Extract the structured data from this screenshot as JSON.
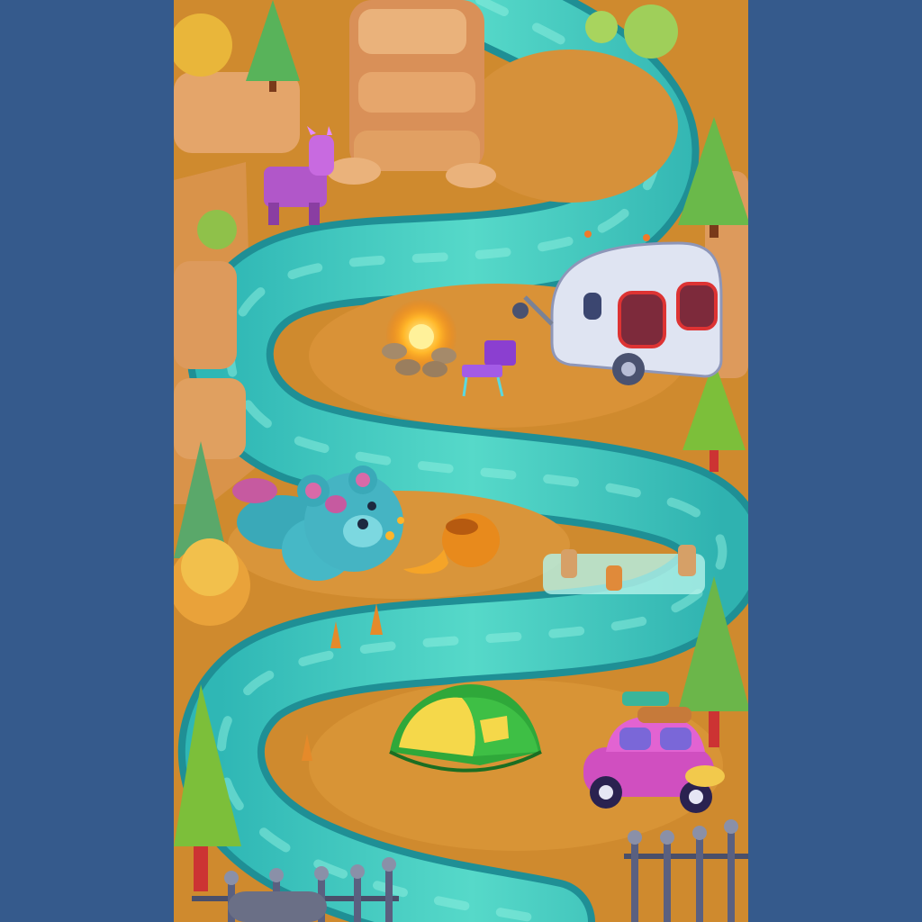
{
  "screen": {
    "type": "game-level-map",
    "background_color": "#355a8c",
    "theme_colors": {
      "ground": "#d89436",
      "river": "#3cc8c0",
      "river_light": "#7fe6d8",
      "cliff": "#e0a05a"
    }
  },
  "map_objects": [
    {
      "key": "rock_pillar",
      "icon": "sandstone-pillar"
    },
    {
      "key": "toy_goat",
      "icon": "purple-toy-goat",
      "color": "#b157c9"
    },
    {
      "key": "campfire",
      "icon": "campfire-icon"
    },
    {
      "key": "folding_chair",
      "icon": "purple-folding-chair",
      "color": "#8b3fd0"
    },
    {
      "key": "camper_trailer",
      "icon": "white-camper-trailer"
    },
    {
      "key": "teddy_bear",
      "icon": "teal-teddy-bear",
      "color": "#3aa9b8"
    },
    {
      "key": "honey_pot",
      "icon": "honey-pot-icon",
      "color": "#e88a1c"
    },
    {
      "key": "rapids",
      "icon": "waterfall-rapids"
    },
    {
      "key": "tent",
      "icon": "green-dome-tent",
      "color": "#2fa83a"
    },
    {
      "key": "toy_car",
      "icon": "pink-windup-car",
      "color": "#d04fc0"
    },
    {
      "key": "fence",
      "icon": "iron-fence"
    },
    {
      "key": "pine_trees",
      "icon": "autumn-pine-tree"
    }
  ]
}
